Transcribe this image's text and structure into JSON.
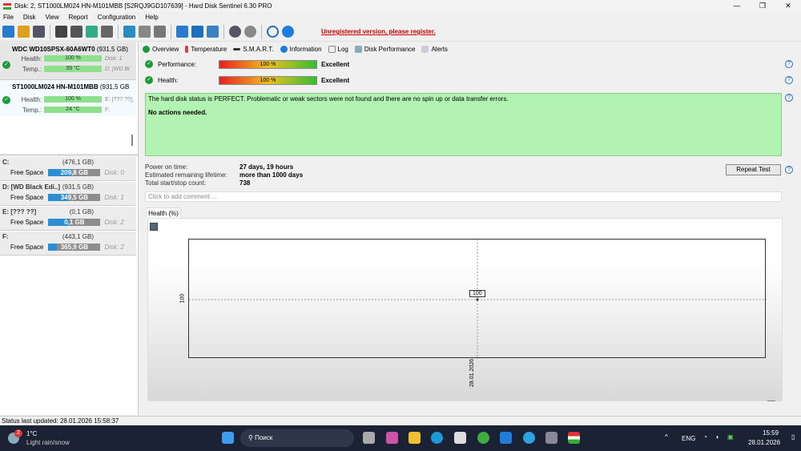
{
  "window": {
    "title": "Disk: 2, ST1000LM024 HN-M101MBB [S2RQJ9GD107639]  -  Hard Disk Sentinel 6.30 PRO",
    "min": "—",
    "max": "❐",
    "close": "✕"
  },
  "menu": [
    "File",
    "Disk",
    "View",
    "Report",
    "Configuration",
    "Help"
  ],
  "toolbar": {
    "register": "Unregistered version, please register."
  },
  "disks": [
    {
      "name": "WDC WD10SPSX-60A6WT0",
      "size": "(931,5 GB)",
      "health_label": "Health:",
      "health": "100 %",
      "health_extra": "Disk: 1",
      "temp_label": "Temp.:",
      "temp": "39 °C",
      "temp_extra": "D: [WD Bl"
    },
    {
      "name": "ST1000LM024 HN-M101MBB",
      "size": "(931,5 GB",
      "health_label": "Health:",
      "health": "100 %",
      "health_extra": "E: [??? ??],",
      "temp_label": "Temp.:",
      "temp": "24 °C",
      "temp_extra": "F:"
    }
  ],
  "partitions": [
    {
      "name": "C:",
      "size": "(476,1 GB)",
      "label": "Free Space",
      "free": "209,8 GB",
      "fill": 44,
      "disk": "Disk: 0"
    },
    {
      "name": "D: [WD Black Edi..]",
      "size": "(931,5 GB)",
      "label": "Free Space",
      "free": "349,5 GB",
      "fill": 38,
      "disk": "Disk: 1"
    },
    {
      "name": "E: [??? ??]",
      "size": "(0,1 GB)",
      "label": "Free Space",
      "free": "0,1 GB",
      "fill": 40,
      "disk": "Disk: 2"
    },
    {
      "name": "F:",
      "size": "(443,1 GB)",
      "label": "Free Space",
      "free": "365,9 GB",
      "fill": 17,
      "disk": "Disk: 2"
    }
  ],
  "tabs": [
    "Overview",
    "Temperature",
    "S.M.A.R.T.",
    "Information",
    "Log",
    "Disk Performance",
    "Alerts"
  ],
  "overview": {
    "performance_label": "Performance:",
    "performance": "100 %",
    "performance_rating": "Excellent",
    "health_label": "Health:",
    "health": "100 %",
    "health_rating": "Excellent",
    "status_text": "The hard disk status is PERFECT. Problematic or weak sectors were not found and there are no spin up or data transfer errors.",
    "actions": "No actions needed.",
    "power_on_label": "Power on time:",
    "power_on": "27 days, 19 hours",
    "lifetime_label": "Estimated remaining lifetime:",
    "lifetime": "more than 1000 days",
    "startstop_label": "Total start/stop count:",
    "startstop": "738",
    "repeat_button": "Repeat Test",
    "comment_placeholder": "Click to add comment ..."
  },
  "chart_data": {
    "type": "line",
    "title": "Health (%)",
    "x": [
      "28.01.2026"
    ],
    "values": [
      100
    ],
    "ytick": "100",
    "point_label": "100"
  },
  "status_bar": "Status last updated: 28.01.2026 15:58:37",
  "taskbar": {
    "weather_temp": "1°C",
    "weather_desc": "Light rain/snow",
    "weather_badge": "2",
    "search": "Поиск",
    "lang": "ENG",
    "time": "15:59",
    "date": "28.01.2026"
  }
}
